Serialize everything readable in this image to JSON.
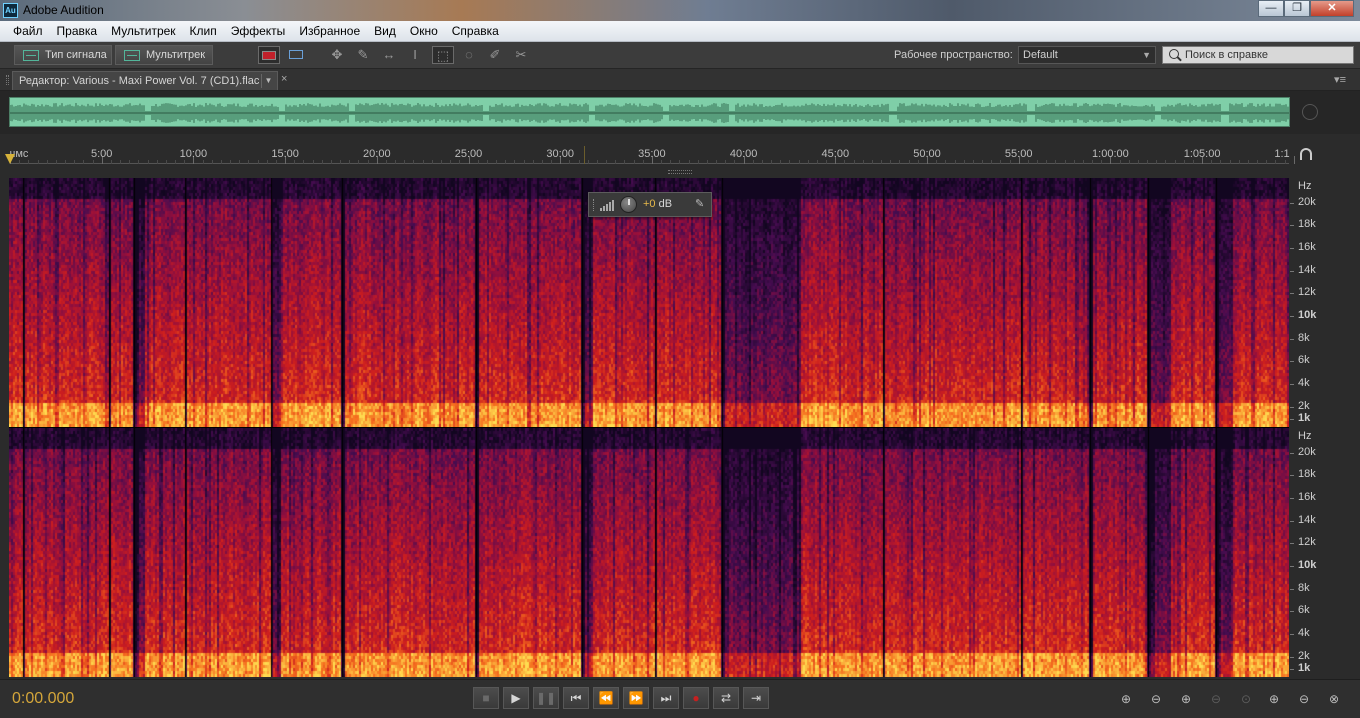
{
  "window": {
    "app_icon": "Au",
    "title": "Adobe Audition",
    "buttons": {
      "minimize": "—",
      "maximize": "❐",
      "close": "✕"
    }
  },
  "menu": [
    "Файл",
    "Правка",
    "Мультитрек",
    "Клип",
    "Эффекты",
    "Избранное",
    "Вид",
    "Окно",
    "Справка"
  ],
  "toolbar": {
    "waveform_view": "Тип сигнала",
    "multitrack_view": "Мультитрек",
    "workspace_label": "Рабочее пространство:",
    "workspace_value": "Default",
    "search_placeholder": "Поиск в справке"
  },
  "editor": {
    "tab_label": "Редактор: Various - Maxi Power Vol. 7 (CD1).flac",
    "close_glyph": "×",
    "panel_menu_glyph": "▾≡"
  },
  "ruler": {
    "labels": [
      "чмс",
      "5:00",
      "10:00",
      "15:00",
      "20:00",
      "25:00",
      "30:00",
      "35:00",
      "40:00",
      "45:00",
      "50:00",
      "55:00",
      "1:00:00",
      "1:05:00",
      "1:1"
    ]
  },
  "hz_scale": {
    "unit": "Hz",
    "labels": [
      "20k",
      "18k",
      "16k",
      "14k",
      "12k",
      "10k",
      "8k",
      "6k",
      "4k",
      "2k",
      "1k"
    ]
  },
  "hud": {
    "value": "+0",
    "unit": "dB"
  },
  "transport": {
    "time": "0:00.000",
    "buttons": [
      "■",
      "▶",
      "❚❚",
      "⏮",
      "⏪",
      "⏩",
      "⏭",
      "●",
      "⇄",
      "⇥"
    ]
  },
  "colors": {
    "accent": "#d4a63a",
    "overview_wave": "#7fcfa8",
    "spectral_low": "#120620",
    "spectral_mid": "#c0143c",
    "spectral_high": "#ffd54a"
  }
}
